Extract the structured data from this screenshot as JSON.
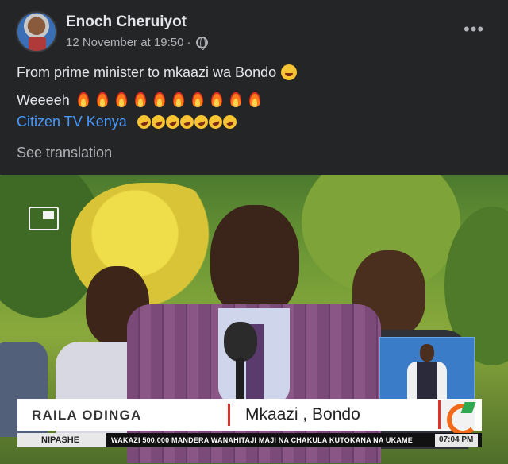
{
  "post": {
    "author": "Enoch Cheruiyot",
    "timestamp": "12 November at 19:50",
    "separator": "·",
    "more_label": "•••",
    "text_line1": "From prime minister to mkaazi wa Bondo",
    "text_line2": "Weeeeh",
    "mention": "Citizen TV Kenya",
    "see_translation": "See translation",
    "fire_emoji_count": 10,
    "laugh_emoji_count": 7
  },
  "video": {
    "lower_third": {
      "name": "RAILA ODINGA",
      "title": "Mkaazi , Bondo"
    },
    "ticker": {
      "label": "NIPASHE",
      "text": "WAKAZI 500,000 MANDERA WANAHITAJI MAJI NA CHAKULA KUTOKANA NA UKAME",
      "time": "07:04 PM"
    }
  },
  "colors": {
    "background": "#242526",
    "link": "#4599ff",
    "brand_red": "#e0312a"
  }
}
